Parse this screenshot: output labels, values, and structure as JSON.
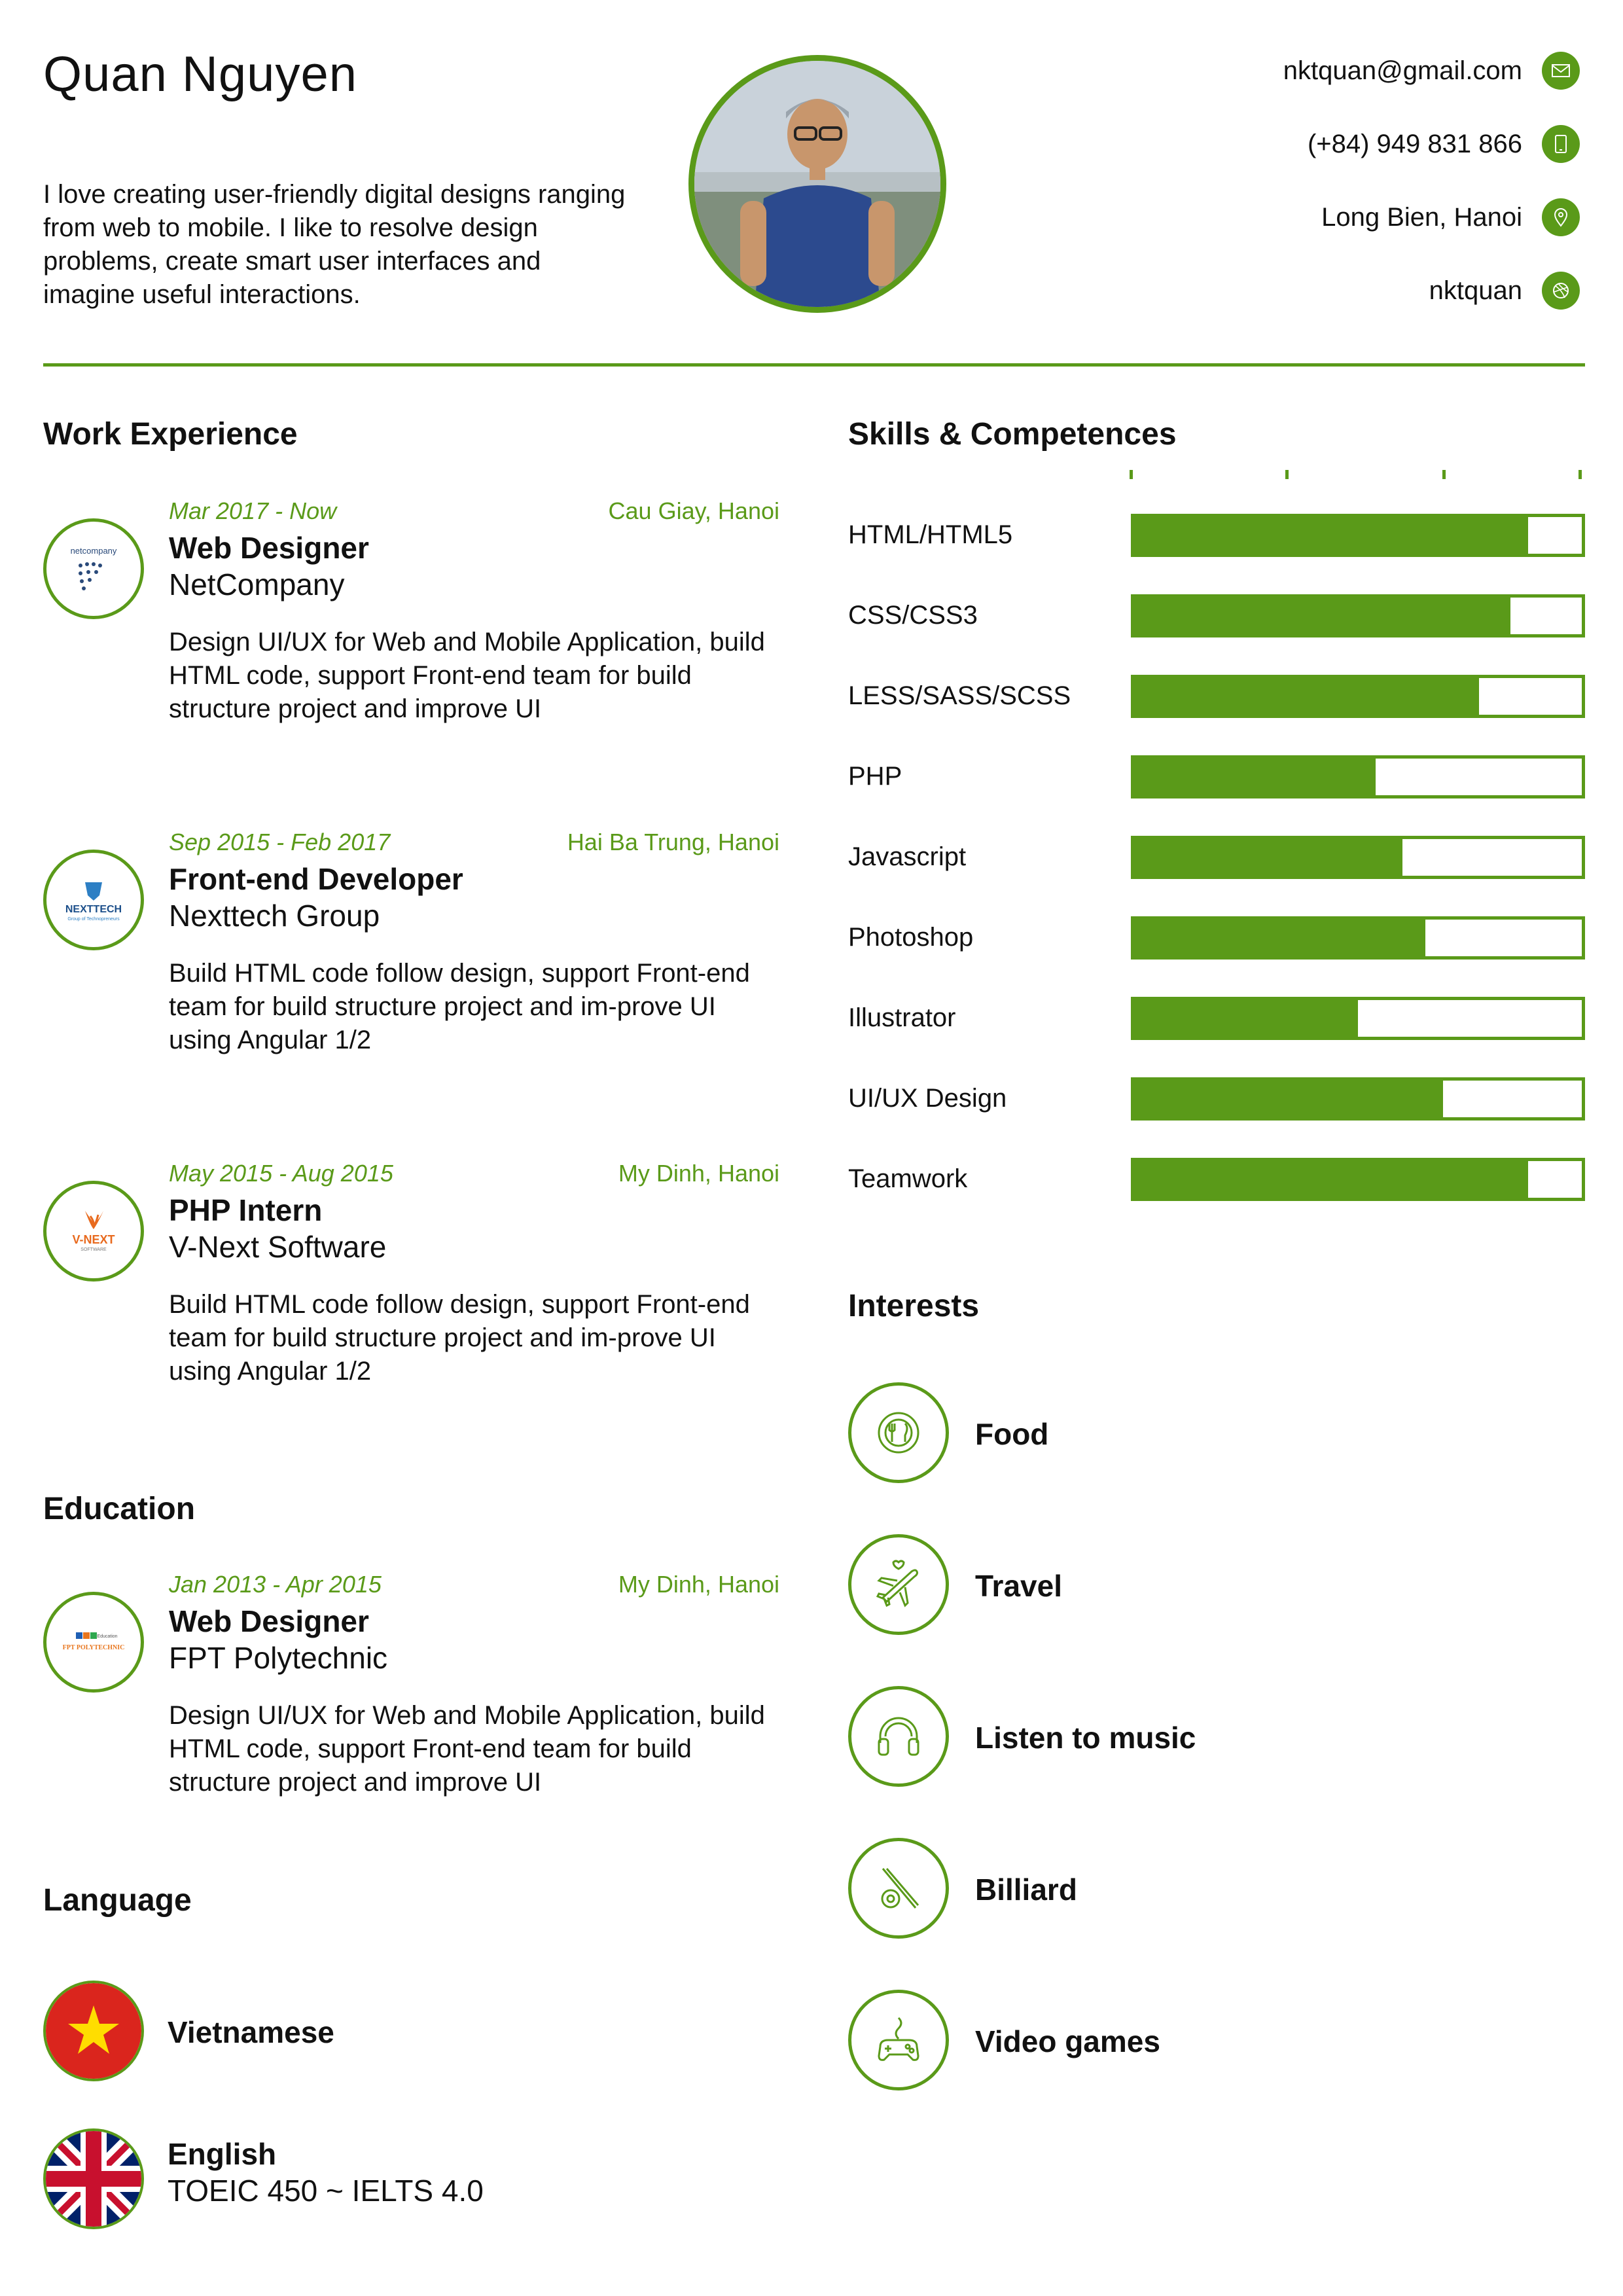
{
  "header": {
    "name": "Quan Nguyen",
    "intro": "I love creating user-friendly digital designs ranging from web to mobile. I like to resolve design problems, create smart user interfaces and imagine useful interactions.",
    "contacts": [
      {
        "text": "nktquan@gmail.com",
        "icon": "mail-icon"
      },
      {
        "text": "(+84) 949 831 866",
        "icon": "phone-icon"
      },
      {
        "text": "Long Bien, Hanoi",
        "icon": "location-pin-icon"
      },
      {
        "text": "nktquan",
        "icon": "dribbble-icon"
      }
    ]
  },
  "work": {
    "title": "Work Experience",
    "jobs": [
      {
        "date": "Mar 2017 - Now",
        "location": "Cau Giay, Hanoi",
        "title": "Web Designer",
        "company": "NetCompany",
        "logo_text": "netcompany",
        "description": "Design UI/UX for Web and Mobile Application, build HTML code, support Front-end team for build structure project and improve UI"
      },
      {
        "date": "Sep 2015 - Feb 2017",
        "location": "Hai Ba Trung, Hanoi",
        "title": "Front-end Developer",
        "company": "Nexttech Group",
        "logo_text": "NEXTTECH",
        "logo_sub": "Group of Technopreneurs",
        "description": "Build HTML code follow design, support Front-end team for build structure project and im-prove UI using Angular 1/2"
      },
      {
        "date": "May 2015 - Aug 2015",
        "location": "My Dinh, Hanoi",
        "title": "PHP Intern",
        "company": "V-Next Software",
        "logo_text": "V-NEXT",
        "logo_sub": "SOFTWARE",
        "description": "Build HTML code follow design, support Front-end team for build structure project and im-prove UI using Angular 1/2"
      }
    ]
  },
  "education": {
    "title": "Education",
    "items": [
      {
        "date": "Jan 2013 - Apr 2015",
        "location": "My Dinh, Hanoi",
        "title": "Web Designer",
        "company": "FPT Polytechnic",
        "logo_text": "FPT POLYTECHNIC",
        "logo_sub": "Education",
        "description": "Design UI/UX for Web and Mobile Application, build HTML code, support Front-end team for build structure project and improve UI"
      }
    ]
  },
  "language": {
    "title": "Language",
    "items": [
      {
        "name": "Vietnamese",
        "detail": "",
        "flag": "vietnam-flag"
      },
      {
        "name": "English",
        "detail": "TOEIC 450 ~ IELTS 4.0",
        "flag": "uk-flag"
      }
    ]
  },
  "skills": {
    "title": "Skills & Competences",
    "items": [
      {
        "name": "HTML/HTML5",
        "level": 0.88
      },
      {
        "name": "CSS/CSS3",
        "level": 0.84
      },
      {
        "name": "LESS/SASS/SCSS",
        "level": 0.77
      },
      {
        "name": "PHP",
        "level": 0.54
      },
      {
        "name": "Javascript",
        "level": 0.6
      },
      {
        "name": "Photoshop",
        "level": 0.65
      },
      {
        "name": "Illustrator",
        "level": 0.5
      },
      {
        "name": "UI/UX Design",
        "level": 0.69
      },
      {
        "name": "Teamwork",
        "level": 0.88
      }
    ]
  },
  "interests": {
    "title": "Interests",
    "items": [
      {
        "name": "Food",
        "icon": "food-plate-icon"
      },
      {
        "name": "Travel",
        "icon": "airplane-icon"
      },
      {
        "name": "Listen to music",
        "icon": "headphones-icon"
      },
      {
        "name": "Billiard",
        "icon": "billiard-cue-icon"
      },
      {
        "name": "Video games",
        "icon": "gamepad-icon"
      }
    ]
  },
  "colors": {
    "accent": "#5a9a19",
    "text": "#111111"
  }
}
